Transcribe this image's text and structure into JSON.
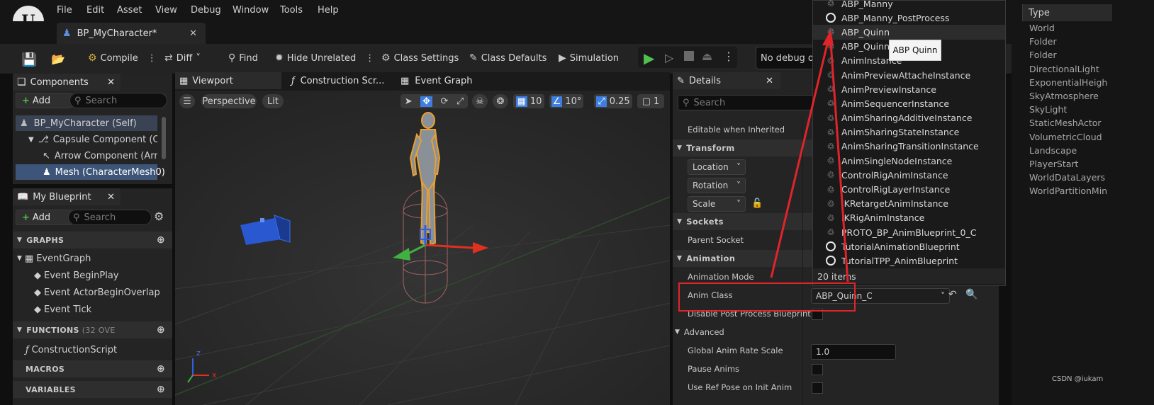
{
  "menu": [
    "File",
    "Edit",
    "Asset",
    "View",
    "Debug",
    "Window",
    "Tools",
    "Help"
  ],
  "logo_text": "U",
  "doc_tab": {
    "title": "BP_MyCharacter*"
  },
  "toolbar": {
    "compile": "Compile",
    "diff": "Diff",
    "find": "Find",
    "hide_unrelated": "Hide Unrelated",
    "class_settings": "Class Settings",
    "class_defaults": "Class Defaults",
    "simulation": "Simulation",
    "debug_object": "No debug obj"
  },
  "components": {
    "tab": "Components",
    "add": "Add",
    "search_placeholder": "Search",
    "items": [
      "BP_MyCharacter (Self)",
      "Capsule Component (Collisi",
      "Arrow Component (Arrow",
      "Mesh (CharacterMesh0)"
    ]
  },
  "blueprint": {
    "tab": "My Blueprint",
    "add": "Add",
    "search_placeholder": "Search",
    "graphs_header": "GRAPHS",
    "event_graph": "EventGraph",
    "events": [
      "Event BeginPlay",
      "Event ActorBeginOverlap",
      "Event Tick"
    ],
    "functions_header": "FUNCTIONS",
    "functions_count": "(32 OVE",
    "construction_script": "ConstructionScript",
    "macros_header": "MACROS",
    "variables_header": "VARIABLES"
  },
  "editor_tabs": {
    "viewport": "Viewport",
    "construction": "Construction Scr...",
    "event_graph": "Event Graph"
  },
  "viewport": {
    "perspective": "Perspective",
    "lit": "Lit",
    "grid_size": "10",
    "rotation_snap": "10°",
    "scale_snap": "0.25",
    "camera_speed": "1",
    "axis_z": "z",
    "axis_x": "x"
  },
  "details": {
    "tab": "Details",
    "search_placeholder": "Search",
    "editable_when_inherited": "Editable when Inherited",
    "transform_header": "Transform",
    "location": "Location",
    "rotation": "Rotation",
    "scale": "Scale",
    "sockets_header": "Sockets",
    "parent_socket": "Parent Socket",
    "animation_header": "Animation",
    "animation_mode": "Animation Mode",
    "anim_class": "Anim Class",
    "anim_class_value": "ABP_Quinn_C",
    "disable_post_process": "Disable Post Process Blueprint",
    "advanced_header": "Advanced",
    "global_anim_rate": "Global Anim Rate Scale",
    "global_anim_rate_value": "1.0",
    "pause_anims": "Pause Anims",
    "use_ref_pose": "Use Ref Pose on Init Anim"
  },
  "picker": {
    "items": [
      {
        "label": "ABP_Manny",
        "icon": "anim"
      },
      {
        "label": "ABP_Manny_PostProcess",
        "icon": "circle"
      },
      {
        "label": "ABP_Quinn",
        "icon": "anim"
      },
      {
        "label": "ABP_Quinn_",
        "icon": "anim"
      },
      {
        "label": "AnimInstance",
        "icon": "anim"
      },
      {
        "label": "AnimPreviewAttacheInstance",
        "icon": "anim"
      },
      {
        "label": "AnimPreviewInstance",
        "icon": "anim"
      },
      {
        "label": "AnimSequencerInstance",
        "icon": "anim"
      },
      {
        "label": "AnimSharingAdditiveInstance",
        "icon": "anim"
      },
      {
        "label": "AnimSharingStateInstance",
        "icon": "anim"
      },
      {
        "label": "AnimSharingTransitionInstance",
        "icon": "anim"
      },
      {
        "label": "AnimSingleNodeInstance",
        "icon": "anim"
      },
      {
        "label": "ControlRigAnimInstance",
        "icon": "anim"
      },
      {
        "label": "ControlRigLayerInstance",
        "icon": "anim"
      },
      {
        "label": "IKRetargetAnimInstance",
        "icon": "anim"
      },
      {
        "label": "IKRigAnimInstance",
        "icon": "anim"
      },
      {
        "label": "PROTO_BP_AnimBlueprint_0_C",
        "icon": "anim"
      },
      {
        "label": "TutorialAnimationBlueprint",
        "icon": "circle"
      },
      {
        "label": "TutorialTPP_AnimBlueprint",
        "icon": "circle"
      }
    ],
    "count": "20 items",
    "tooltip": "ABP Quinn"
  },
  "outliner": {
    "type_header": "Type",
    "types": [
      "World",
      "Folder",
      "Folder",
      "DirectionalLight",
      "ExponentialHeightI",
      "SkyAtmosphere",
      "SkyLight",
      "StaticMeshActor",
      "VolumetricCloud",
      "Landscape",
      "PlayerStart",
      "WorldDataLayers",
      "WorldPartitionMini"
    ]
  },
  "watermark": "CSDN @iukam",
  "colors": {
    "accent": "#3d7ee0",
    "annotation_red": "#e0242a",
    "play_green": "#4fc04f"
  }
}
